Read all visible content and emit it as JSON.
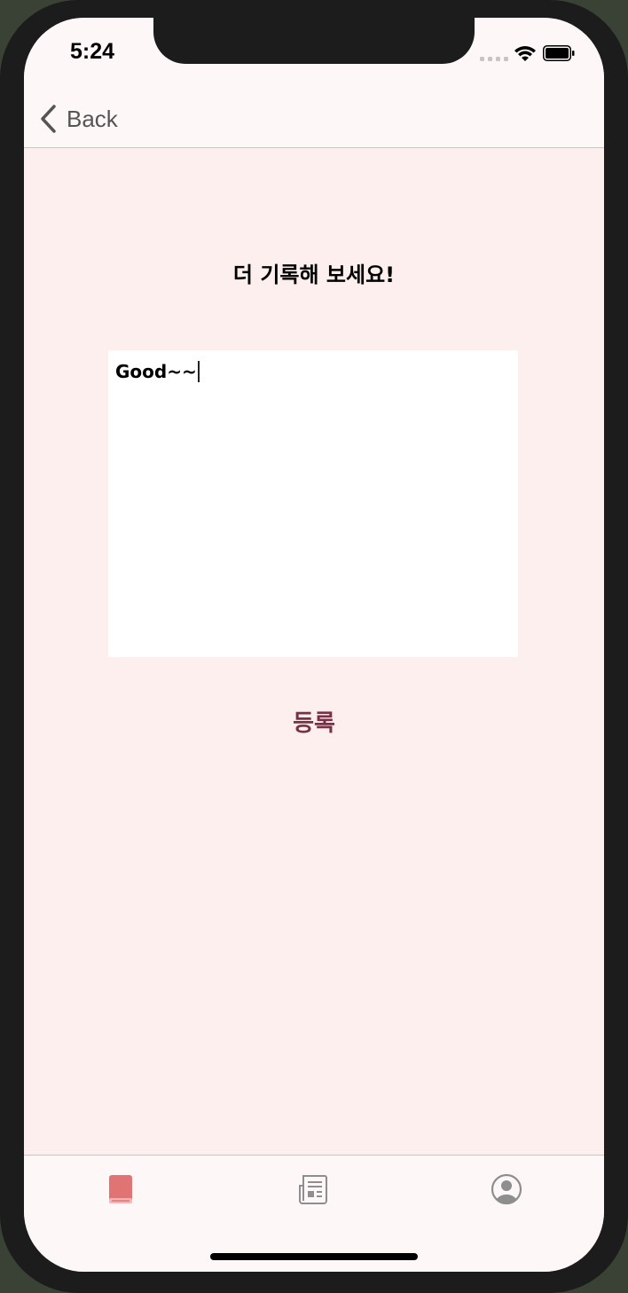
{
  "status_bar": {
    "time": "5:24"
  },
  "nav": {
    "back_label": "Back",
    "back_icon": "chevron-left-icon"
  },
  "main": {
    "title": "더 기록해 보세요!",
    "memo_value": "Good~~",
    "submit_label": "등록"
  },
  "tab_bar": {
    "items": [
      {
        "icon": "book-icon",
        "active": true
      },
      {
        "icon": "newspaper-icon",
        "active": false
      },
      {
        "icon": "profile-icon",
        "active": false
      }
    ]
  },
  "colors": {
    "background": "#fcefee",
    "bar_background": "#fdf8f7",
    "accent": "#7a3047",
    "active_tab": "#e07373",
    "inactive_tab": "#8e8e8e"
  }
}
